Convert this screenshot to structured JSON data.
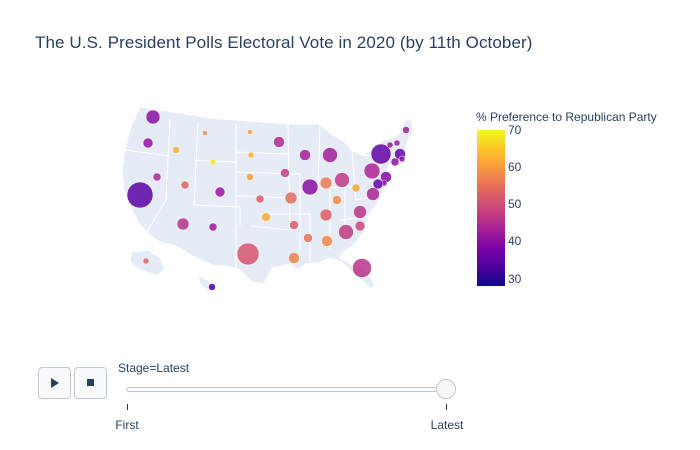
{
  "chart_data": {
    "type": "scatter",
    "title": "The U.S. President Polls Electoral Vote in 2020 (by 11th October)",
    "geo": "usa",
    "color_scale": "plasma",
    "colorbar": {
      "title": "% Preference to Republican Party",
      "range": [
        28,
        70
      ],
      "ticks": [
        30,
        40,
        50,
        60,
        70
      ]
    },
    "points": [
      {
        "name": "WA",
        "value": 40
      },
      {
        "name": "OR",
        "value": 41
      },
      {
        "name": "CA",
        "value": 35
      },
      {
        "name": "NV",
        "value": 44
      },
      {
        "name": "ID",
        "value": 62
      },
      {
        "name": "MT",
        "value": 58
      },
      {
        "name": "WY",
        "value": 68
      },
      {
        "name": "UT",
        "value": 53
      },
      {
        "name": "AZ",
        "value": 46
      },
      {
        "name": "CO",
        "value": 42
      },
      {
        "name": "NM",
        "value": 42
      },
      {
        "name": "ND",
        "value": 60
      },
      {
        "name": "SD",
        "value": 62
      },
      {
        "name": "NE",
        "value": 60
      },
      {
        "name": "KS",
        "value": 52
      },
      {
        "name": "OK",
        "value": 62
      },
      {
        "name": "TX",
        "value": 51
      },
      {
        "name": "MN",
        "value": 45
      },
      {
        "name": "IA",
        "value": 48
      },
      {
        "name": "MO",
        "value": 54
      },
      {
        "name": "AR",
        "value": 52
      },
      {
        "name": "LA",
        "value": 57
      },
      {
        "name": "WI",
        "value": 43
      },
      {
        "name": "IL",
        "value": 40
      },
      {
        "name": "MI",
        "value": 43
      },
      {
        "name": "IN",
        "value": 56
      },
      {
        "name": "OH",
        "value": 47
      },
      {
        "name": "KY",
        "value": 58
      },
      {
        "name": "TN",
        "value": 52
      },
      {
        "name": "MS",
        "value": 55
      },
      {
        "name": "AL",
        "value": 58
      },
      {
        "name": "GA",
        "value": 47
      },
      {
        "name": "FL",
        "value": 46
      },
      {
        "name": "SC",
        "value": 49
      },
      {
        "name": "NC",
        "value": 46
      },
      {
        "name": "VA",
        "value": 44
      },
      {
        "name": "WV",
        "value": 61
      },
      {
        "name": "PA",
        "value": 44
      },
      {
        "name": "NY",
        "value": 36
      },
      {
        "name": "ME",
        "value": 43
      },
      {
        "name": "VT",
        "value": 42
      },
      {
        "name": "NH",
        "value": 42
      },
      {
        "name": "MA",
        "value": 36
      },
      {
        "name": "RI",
        "value": 40
      },
      {
        "name": "CT",
        "value": 40
      },
      {
        "name": "NJ",
        "value": 39
      },
      {
        "name": "DE",
        "value": 38
      },
      {
        "name": "MD",
        "value": 36
      },
      {
        "name": "AK",
        "value": 53
      },
      {
        "name": "HI",
        "value": 34
      }
    ]
  },
  "controls": {
    "play_icon": "play-icon",
    "stop_icon": "stop-icon",
    "slider_label": "Stage=Latest",
    "steps": [
      "First",
      "Latest"
    ],
    "current_step": "Latest"
  }
}
